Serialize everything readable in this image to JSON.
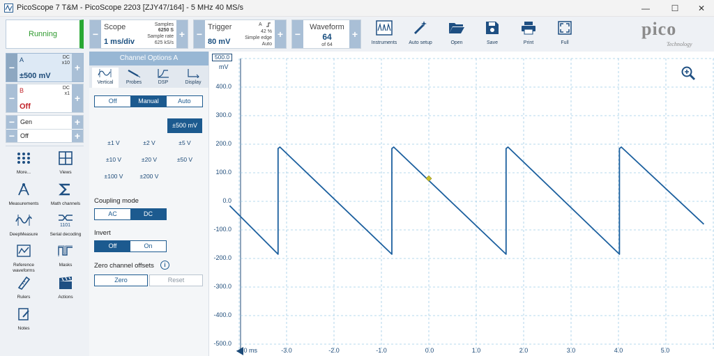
{
  "window": {
    "title": "PicoScope 7 T&M  - PicoScope 2203 [ZJY47/164] - 5 MHz 40 MS/s",
    "minimize_glyph": "—",
    "maximize_glyph": "☐",
    "close_glyph": "✕"
  },
  "toolbar": {
    "run_status": "Running",
    "scope": {
      "title": "Scope",
      "timebase": "1 ms/div",
      "samples_label": "Samples",
      "samples_value": "6250 S",
      "rate_label": "Sample rate",
      "rate_value": "625 kS/s"
    },
    "trigger": {
      "title": "Trigger",
      "level": "80 mV",
      "source": "A",
      "position": "42 %",
      "type": "Simple edge",
      "mode": "Auto"
    },
    "waveform": {
      "title": "Waveform",
      "current": "64",
      "total": "of 64"
    },
    "buttons": [
      {
        "label": "Instruments",
        "icon": "instruments-icon"
      },
      {
        "label": "Auto setup",
        "icon": "auto-setup-wand-icon"
      },
      {
        "label": "Open",
        "icon": "folder-open-icon"
      },
      {
        "label": "Save",
        "icon": "floppy-disk-icon"
      },
      {
        "label": "Print",
        "icon": "printer-icon"
      },
      {
        "label": "Full",
        "icon": "fullscreen-icon"
      }
    ],
    "logo_text": "pico",
    "logo_sub": "Technology"
  },
  "channels": {
    "a": {
      "name": "A",
      "coupling": "DC",
      "probe": "x10",
      "range": "±500 mV"
    },
    "b": {
      "name": "B",
      "coupling": "DC",
      "probe": "x1",
      "state": "Off"
    },
    "gen": {
      "name": "Gen",
      "state": "Off"
    }
  },
  "tools": [
    {
      "label": "More...",
      "icon": "more-dots-icon"
    },
    {
      "label": "Views",
      "icon": "views-grid-icon"
    },
    {
      "label": "Measurements",
      "icon": "measurements-icon"
    },
    {
      "label": "Math channels",
      "icon": "sigma-icon"
    },
    {
      "label": "DeepMeasure",
      "icon": "deepmeasure-icon"
    },
    {
      "label": "Serial decoding",
      "icon": "serial-decoding-icon"
    },
    {
      "label": "Reference waveforms",
      "icon": "reference-waveform-icon"
    },
    {
      "label": "Masks",
      "icon": "masks-icon"
    },
    {
      "label": "Rulers",
      "icon": "ruler-icon"
    },
    {
      "label": "Actions",
      "icon": "clapperboard-icon"
    },
    {
      "label": "Notes",
      "icon": "notes-icon"
    }
  ],
  "channel_options": {
    "header": "Channel Options A",
    "tabs": [
      "Vertical",
      "Probes",
      "DSP",
      "Display"
    ],
    "range_mode": [
      "Off",
      "Manual",
      "Auto"
    ],
    "selected_range": "±500 mV",
    "ranges": [
      "±1 V",
      "±2 V",
      "±5 V",
      "±10 V",
      "±20 V",
      "±50 V",
      "±100 V",
      "±200 V"
    ],
    "coupling_title": "Coupling mode",
    "coupling": [
      "AC",
      "DC"
    ],
    "invert_title": "Invert",
    "invert": [
      "Off",
      "On"
    ],
    "zero_title": "Zero channel offsets",
    "info_glyph": "i",
    "zero_button": "Zero",
    "reset_button": "Reset"
  },
  "plot": {
    "y_unit": "mV",
    "y_top_label": "500.0",
    "y_ticks": [
      "400.0",
      "300.0",
      "200.0",
      "100.0",
      "0.0",
      "-100.0",
      "-200.0",
      "-300.0",
      "-400.0",
      "-500.0"
    ],
    "x_first_label": "-4.0 ms",
    "x_ticks": [
      "-3.0",
      "-2.0",
      "-1.0",
      "0.0",
      "1.0",
      "2.0",
      "3.0",
      "4.0",
      "5.0"
    ],
    "trace_color": "#1b5f9e",
    "grid_color": "#9fcbe6"
  },
  "chart_data": {
    "type": "line",
    "title": "",
    "xlabel": "ms",
    "ylabel": "mV",
    "xlim": [
      -4.2,
      6.0
    ],
    "ylim": [
      -500,
      500
    ],
    "grid": true,
    "series": [
      {
        "color": "#1b5f9e",
        "x": [
          -4.2,
          -3.18,
          -3.18,
          -3.14,
          -0.78,
          -0.78,
          -0.74,
          1.63,
          1.63,
          1.67,
          4.02,
          4.02,
          4.06,
          5.8
        ],
        "y": [
          -15,
          -185,
          185,
          190,
          -185,
          185,
          190,
          -185,
          185,
          190,
          -185,
          185,
          190,
          -80
        ]
      }
    ],
    "trigger_marker": {
      "x": 0.0,
      "y": 80,
      "color": "#c8c02a"
    }
  }
}
